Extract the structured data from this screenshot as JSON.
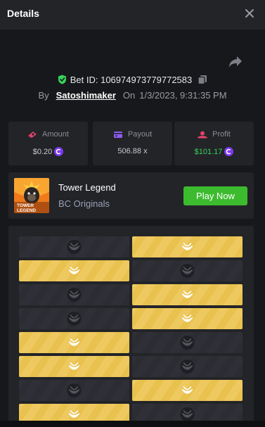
{
  "header": {
    "title": "Details"
  },
  "bet": {
    "id_label": "Bet ID: 106974973779772583",
    "by_label": "By",
    "username": "Satoshimaker",
    "on_label": "On",
    "datetime": "1/3/2023, 9:31:35 PM"
  },
  "stats": {
    "amount": {
      "label": "Amount",
      "value": "$0.20"
    },
    "payout": {
      "label": "Payout",
      "value": "506.88 x"
    },
    "profit": {
      "label": "Profit",
      "value": "$101.17"
    }
  },
  "game": {
    "name": "Tower Legend",
    "provider": "BC Originals",
    "thumb_text_1": "TOWER",
    "thumb_text_2": "LEGEND",
    "play_label": "Play Now"
  },
  "board": {
    "rows": [
      [
        "dark",
        "gold"
      ],
      [
        "gold",
        "dark"
      ],
      [
        "dark",
        "gold"
      ],
      [
        "dark",
        "gold"
      ],
      [
        "gold",
        "dark"
      ],
      [
        "gold",
        "dark"
      ],
      [
        "dark",
        "gold"
      ],
      [
        "gold",
        "dark"
      ]
    ]
  },
  "icons": {
    "shield": "shield-check-icon",
    "copy": "copy-icon",
    "share": "share-icon",
    "close": "close-icon",
    "amount": "money-icon",
    "payout": "payout-icon",
    "profit": "profit-icon",
    "coin": "coin-icon",
    "tile": "banana-icon"
  },
  "colors": {
    "accent_green": "#3dbb2f",
    "profit_green": "#36d15c",
    "gold_tile": "#e8c14f",
    "dark_tile": "#2c2d33",
    "coin_purple": "#7c3aed"
  }
}
